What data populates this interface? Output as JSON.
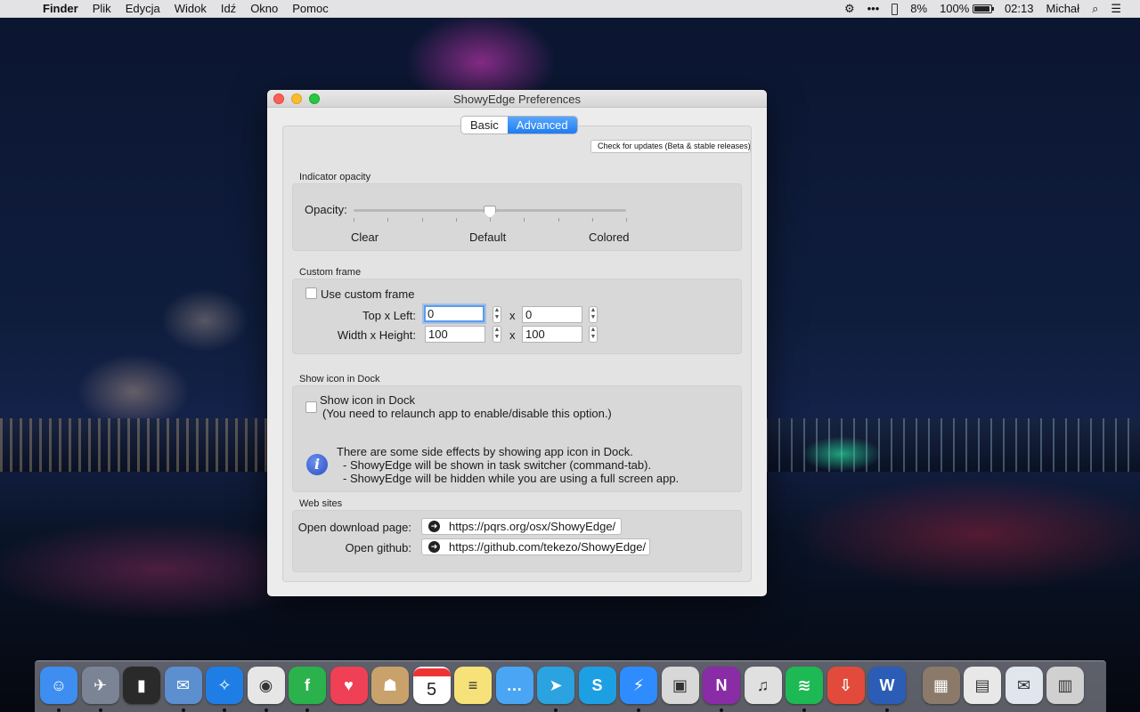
{
  "menubar": {
    "app": "Finder",
    "items": [
      "Plik",
      "Edycja",
      "Widok",
      "Idź",
      "Okno",
      "Pomoc"
    ],
    "status": {
      "more": "•••",
      "phone_battery": "8%",
      "battery": "100%",
      "time": "02:13",
      "user": "Michał"
    }
  },
  "window": {
    "title": "ShowyEdge Preferences",
    "tabs": [
      "Basic",
      "Advanced"
    ],
    "active_tab": "Advanced",
    "update_button": "Check for updates (Beta & stable releases)",
    "opacity": {
      "section": "Indicator opacity",
      "label": "Opacity:",
      "min_label": "Clear",
      "mid_label": "Default",
      "max_label": "Colored",
      "value_fraction": 0.5
    },
    "custom_frame": {
      "section": "Custom frame",
      "checkbox": "Use custom frame",
      "top_left_label": "Top x Left:",
      "size_label": "Width x Height:",
      "x": "x",
      "top": "0",
      "left": "0",
      "width": "100",
      "height": "100"
    },
    "dock": {
      "section": "Show icon in Dock",
      "checkbox": "Show icon in Dock",
      "note": "(You need to relaunch app to enable/disable this option.)",
      "info_line1": "There are some side effects by showing app icon in Dock.",
      "info_line2": "- ShowyEdge will be shown in task switcher (command-tab).",
      "info_line3": "- ShowyEdge will be hidden while you are using a full screen app."
    },
    "websites": {
      "section": "Web sites",
      "download_label": "Open download page:",
      "download_url": "https://pqrs.org/osx/ShowyEdge/",
      "github_label": "Open github:",
      "github_url": "https://github.com/tekezo/ShowyEdge/"
    }
  },
  "dock_apps": [
    {
      "name": "finder",
      "color": "#3d8ef0"
    },
    {
      "name": "launchpad",
      "color": "#7b8494"
    },
    {
      "name": "activity-monitor",
      "color": "#2a2a2a"
    },
    {
      "name": "mail",
      "color": "#5c8fd0"
    },
    {
      "name": "safari",
      "color": "#1f7ee6"
    },
    {
      "name": "chrome",
      "color": "#e6e6e6"
    },
    {
      "name": "feedly",
      "color": "#2bb24c"
    },
    {
      "name": "pocket",
      "color": "#ef4056"
    },
    {
      "name": "contacts",
      "color": "#c9a26b"
    },
    {
      "name": "calendar",
      "color": "#ffffff"
    },
    {
      "name": "notes",
      "color": "#f7e27a"
    },
    {
      "name": "messages",
      "color": "#4aa6f5"
    },
    {
      "name": "telegram",
      "color": "#2aa3e0"
    },
    {
      "name": "skype",
      "color": "#1d9fe4"
    },
    {
      "name": "messenger",
      "color": "#2e8cff"
    },
    {
      "name": "preview",
      "color": "#d8d8d8"
    },
    {
      "name": "onenote",
      "color": "#8a2ca6"
    },
    {
      "name": "itunes",
      "color": "#e0e0e0"
    },
    {
      "name": "spotify",
      "color": "#1db954"
    },
    {
      "name": "downloader",
      "color": "#e24b3b"
    },
    {
      "name": "word",
      "color": "#2b5db7"
    },
    {
      "name": "photos-folder",
      "color": "#8b7a6a"
    },
    {
      "name": "jpeg-file",
      "color": "#e8e8e8"
    },
    {
      "name": "mail-doc",
      "color": "#dfe6ee"
    },
    {
      "name": "trash",
      "color": "#d0d0d0"
    }
  ],
  "calendar_day": "5"
}
